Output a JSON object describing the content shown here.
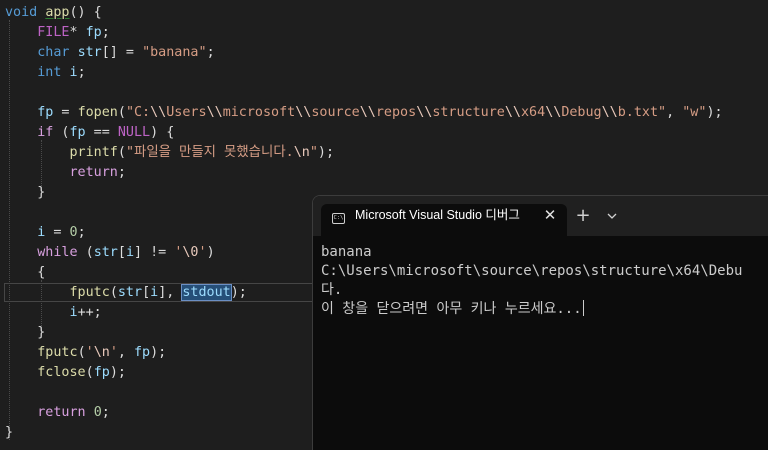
{
  "editor": {
    "lines": [
      {
        "segments": [
          {
            "cls": "kw",
            "t": "void"
          },
          {
            "cls": "plain",
            "t": " "
          },
          {
            "cls": "fn app-name",
            "t": "app"
          },
          {
            "cls": "plain",
            "t": "() {"
          }
        ]
      },
      {
        "segments": [
          {
            "cls": "plain",
            "t": "    "
          },
          {
            "cls": "mac",
            "t": "FILE"
          },
          {
            "cls": "plain",
            "t": "* "
          },
          {
            "cls": "var",
            "t": "fp"
          },
          {
            "cls": "plain",
            "t": ";"
          }
        ]
      },
      {
        "segments": [
          {
            "cls": "plain",
            "t": "    "
          },
          {
            "cls": "kw",
            "t": "char"
          },
          {
            "cls": "plain",
            "t": " "
          },
          {
            "cls": "var",
            "t": "str"
          },
          {
            "cls": "plain",
            "t": "[] = "
          },
          {
            "cls": "str",
            "t": "\"banana\""
          },
          {
            "cls": "plain",
            "t": ";"
          }
        ]
      },
      {
        "segments": [
          {
            "cls": "plain",
            "t": "    "
          },
          {
            "cls": "kw",
            "t": "int"
          },
          {
            "cls": "plain",
            "t": " "
          },
          {
            "cls": "var",
            "t": "i"
          },
          {
            "cls": "plain",
            "t": ";"
          }
        ]
      },
      {
        "segments": []
      },
      {
        "segments": [
          {
            "cls": "plain",
            "t": "    "
          },
          {
            "cls": "var",
            "t": "fp"
          },
          {
            "cls": "plain",
            "t": " = "
          },
          {
            "cls": "fn",
            "t": "fopen"
          },
          {
            "cls": "plain",
            "t": "("
          },
          {
            "cls": "str",
            "t": "\"C:"
          },
          {
            "cls": "esc",
            "t": "\\\\"
          },
          {
            "cls": "str",
            "t": "Users"
          },
          {
            "cls": "esc",
            "t": "\\\\"
          },
          {
            "cls": "str",
            "t": "microsoft"
          },
          {
            "cls": "esc",
            "t": "\\\\"
          },
          {
            "cls": "str",
            "t": "source"
          },
          {
            "cls": "esc",
            "t": "\\\\"
          },
          {
            "cls": "str",
            "t": "repos"
          },
          {
            "cls": "esc",
            "t": "\\\\"
          },
          {
            "cls": "str",
            "t": "structure"
          },
          {
            "cls": "esc",
            "t": "\\\\"
          },
          {
            "cls": "str",
            "t": "x64"
          },
          {
            "cls": "esc",
            "t": "\\\\"
          },
          {
            "cls": "str",
            "t": "Debug"
          },
          {
            "cls": "esc",
            "t": "\\\\"
          },
          {
            "cls": "str",
            "t": "b.txt\""
          },
          {
            "cls": "plain",
            "t": ", "
          },
          {
            "cls": "str",
            "t": "\"w\""
          },
          {
            "cls": "plain",
            "t": ");"
          }
        ]
      },
      {
        "segments": [
          {
            "cls": "plain",
            "t": "    "
          },
          {
            "cls": "ctl",
            "t": "if"
          },
          {
            "cls": "plain",
            "t": " ("
          },
          {
            "cls": "var",
            "t": "fp"
          },
          {
            "cls": "plain",
            "t": " == "
          },
          {
            "cls": "mac",
            "t": "NULL"
          },
          {
            "cls": "plain",
            "t": ") {"
          }
        ]
      },
      {
        "segments": [
          {
            "cls": "plain",
            "t": "        "
          },
          {
            "cls": "fn",
            "t": "printf"
          },
          {
            "cls": "plain",
            "t": "("
          },
          {
            "cls": "str",
            "t": "\"파일을 만들지 못했습니다."
          },
          {
            "cls": "esc",
            "t": "\\n"
          },
          {
            "cls": "str",
            "t": "\""
          },
          {
            "cls": "plain",
            "t": ");"
          }
        ]
      },
      {
        "segments": [
          {
            "cls": "plain",
            "t": "        "
          },
          {
            "cls": "ctl",
            "t": "return"
          },
          {
            "cls": "plain",
            "t": ";"
          }
        ]
      },
      {
        "segments": [
          {
            "cls": "plain",
            "t": "    }"
          }
        ]
      },
      {
        "segments": []
      },
      {
        "segments": [
          {
            "cls": "plain",
            "t": "    "
          },
          {
            "cls": "var",
            "t": "i"
          },
          {
            "cls": "plain",
            "t": " = "
          },
          {
            "cls": "num",
            "t": "0"
          },
          {
            "cls": "plain",
            "t": ";"
          }
        ]
      },
      {
        "segments": [
          {
            "cls": "plain",
            "t": "    "
          },
          {
            "cls": "ctl",
            "t": "while"
          },
          {
            "cls": "plain",
            "t": " ("
          },
          {
            "cls": "var",
            "t": "str"
          },
          {
            "cls": "plain",
            "t": "["
          },
          {
            "cls": "var",
            "t": "i"
          },
          {
            "cls": "plain",
            "t": "] != "
          },
          {
            "cls": "str",
            "t": "'"
          },
          {
            "cls": "esc",
            "t": "\\0"
          },
          {
            "cls": "str",
            "t": "'"
          },
          {
            "cls": "plain",
            "t": ")"
          }
        ]
      },
      {
        "segments": [
          {
            "cls": "plain",
            "t": "    {"
          }
        ]
      },
      {
        "segments": [
          {
            "cls": "plain",
            "t": "        "
          },
          {
            "cls": "fn",
            "t": "fputc"
          },
          {
            "cls": "plain",
            "t": "("
          },
          {
            "cls": "var",
            "t": "str"
          },
          {
            "cls": "plain",
            "t": "["
          },
          {
            "cls": "var",
            "t": "i"
          },
          {
            "cls": "plain",
            "t": "], "
          },
          {
            "cls": "var sel-word",
            "t": "stdout"
          },
          {
            "cls": "plain",
            "t": ");"
          }
        ]
      },
      {
        "segments": [
          {
            "cls": "plain",
            "t": "        "
          },
          {
            "cls": "var",
            "t": "i"
          },
          {
            "cls": "plain",
            "t": "++;"
          }
        ]
      },
      {
        "segments": [
          {
            "cls": "plain",
            "t": "    }"
          }
        ]
      },
      {
        "segments": [
          {
            "cls": "plain",
            "t": "    "
          },
          {
            "cls": "fn",
            "t": "fputc"
          },
          {
            "cls": "plain",
            "t": "("
          },
          {
            "cls": "str",
            "t": "'"
          },
          {
            "cls": "esc",
            "t": "\\n"
          },
          {
            "cls": "str",
            "t": "'"
          },
          {
            "cls": "plain",
            "t": ", "
          },
          {
            "cls": "var",
            "t": "fp"
          },
          {
            "cls": "plain",
            "t": ");"
          }
        ]
      },
      {
        "segments": [
          {
            "cls": "plain",
            "t": "    "
          },
          {
            "cls": "fn",
            "t": "fclose"
          },
          {
            "cls": "plain",
            "t": "("
          },
          {
            "cls": "var",
            "t": "fp"
          },
          {
            "cls": "plain",
            "t": ");"
          }
        ]
      },
      {
        "segments": []
      },
      {
        "segments": [
          {
            "cls": "plain",
            "t": "    "
          },
          {
            "cls": "ctl",
            "t": "return"
          },
          {
            "cls": "plain",
            "t": " "
          },
          {
            "cls": "num",
            "t": "0"
          },
          {
            "cls": "plain",
            "t": ";"
          }
        ]
      },
      {
        "segments": [
          {
            "cls": "plain",
            "t": "}"
          }
        ]
      }
    ]
  },
  "terminal": {
    "tab_title": "Microsoft Visual Studio 디버그",
    "tab_icon_text": "C:\\",
    "close_glyph": "✕",
    "new_tab_glyph": "+",
    "dropdown_icon": "chevron-down-icon",
    "output_lines": [
      "banana",
      "C:\\Users\\microsoft\\source\\repos\\structure\\x64\\Debu",
      "다.",
      "이 창을 닫으려면 아무 키나 누르세요..."
    ]
  },
  "colors": {
    "editor_bg": "#1e1e1e",
    "keyword": "#569cd6",
    "control": "#d8a0df",
    "function": "#dcdcaa",
    "variable": "#9cdcfe",
    "macro": "#bd63c5",
    "string": "#d69d85",
    "number": "#b5cea8",
    "terminal_bg": "#0c0c0c",
    "terminal_titlebar": "#202020"
  }
}
